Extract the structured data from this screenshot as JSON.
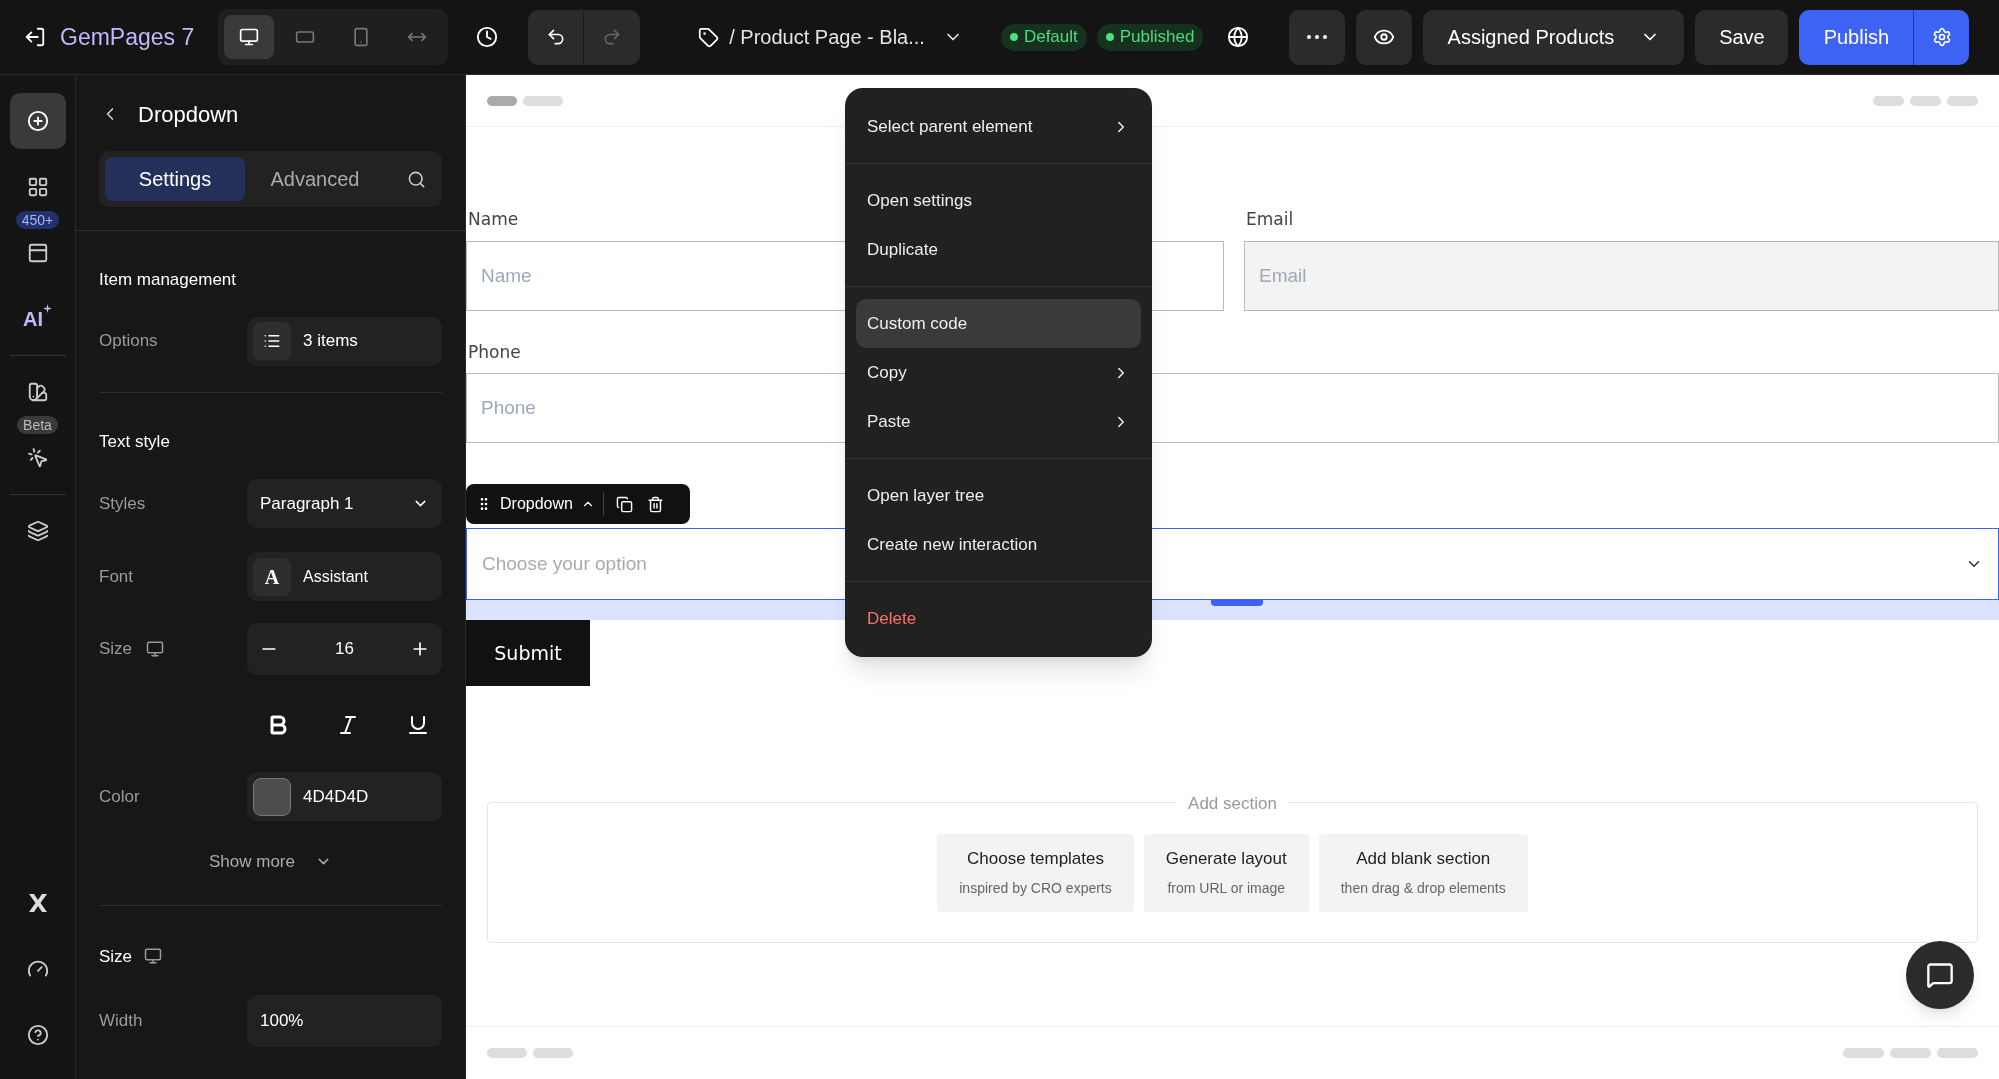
{
  "topbar": {
    "brand": "GemPages 7",
    "device_modes": [
      {
        "kind": "desktop",
        "selected": true
      },
      {
        "kind": "tablet",
        "selected": false
      },
      {
        "kind": "mobile",
        "selected": false
      },
      {
        "kind": "fit",
        "selected": false
      }
    ],
    "page_title": "/ Product Page - Bla...",
    "badges": [
      {
        "label": "Default",
        "color": "#4ade80"
      },
      {
        "label": "Published",
        "color": "#4ade80"
      }
    ],
    "assigned": "Assigned Products",
    "save": "Save",
    "publish": "Publish"
  },
  "rail": {
    "groups": [
      [
        {
          "kind": "add",
          "selected": true
        },
        {
          "kind": "elements",
          "selected": false
        },
        {
          "kind": "templates",
          "badge": "450+",
          "selected": false
        },
        {
          "kind": "ai",
          "text": "AI",
          "selected": false
        }
      ],
      [
        {
          "kind": "theme",
          "selected": false
        },
        {
          "kind": "interaction",
          "badge": "Beta",
          "selected": false
        }
      ],
      [
        {
          "kind": "layers",
          "selected": false
        }
      ]
    ],
    "bottom": [
      {
        "kind": "x",
        "selected": false
      },
      {
        "kind": "speed",
        "selected": false
      },
      {
        "kind": "help",
        "selected": false
      }
    ]
  },
  "panel": {
    "title": "Dropdown",
    "tabs": [
      {
        "label": "Settings",
        "selected": true
      },
      {
        "label": "Advanced",
        "selected": false
      }
    ],
    "item_management": {
      "heading": "Item management",
      "options_label": "Options",
      "options_value": "3 items"
    },
    "text_style": {
      "heading": "Text style",
      "styles_label": "Styles",
      "styles_value": "Paragraph 1",
      "font_label": "Font",
      "font_glyph": "A",
      "font_value": "Assistant",
      "size_label": "Size",
      "size_value": "16",
      "color_label": "Color",
      "color": "#4d4d4d",
      "color_value": "4D4D4D",
      "show_more": "Show more"
    },
    "size": {
      "heading": "Size",
      "width_label": "Width",
      "width_value": "100%"
    }
  },
  "form": {
    "rows": [
      [
        {
          "label": "Name",
          "placeholder": "Name",
          "disabled": false
        },
        {
          "label": "Email",
          "placeholder": "Email",
          "disabled": true
        }
      ],
      [
        {
          "label": "Phone",
          "placeholder": "Phone",
          "disabled": false
        }
      ]
    ],
    "dropdown": {
      "toolbar_label": "Dropdown",
      "placeholder": "Choose your option",
      "selected": true
    },
    "submit": "Submit"
  },
  "context_menu": {
    "groups": [
      [
        {
          "label": "Select parent element",
          "submenu": true,
          "kind": "normal",
          "selected": false
        }
      ],
      [
        {
          "label": "Open settings",
          "submenu": false,
          "kind": "normal",
          "selected": false
        },
        {
          "label": "Duplicate",
          "submenu": false,
          "kind": "normal",
          "selected": false
        }
      ],
      [
        {
          "label": "Custom code",
          "submenu": false,
          "kind": "normal",
          "selected": true
        },
        {
          "label": "Copy",
          "submenu": true,
          "kind": "normal",
          "selected": false
        },
        {
          "label": "Paste",
          "submenu": true,
          "kind": "normal",
          "selected": false
        }
      ],
      [
        {
          "label": "Open layer tree",
          "submenu": false,
          "kind": "normal",
          "selected": false
        },
        {
          "label": "Create new interaction",
          "submenu": false,
          "kind": "normal",
          "selected": false
        }
      ],
      [
        {
          "label": "Delete",
          "submenu": false,
          "kind": "danger",
          "selected": false
        }
      ]
    ]
  },
  "add_section": {
    "title": "Add section",
    "options": [
      {
        "title": "Choose templates",
        "subtitle": "inspired by CRO experts"
      },
      {
        "title": "Generate layout",
        "subtitle": "from URL or image"
      },
      {
        "title": "Add blank section",
        "subtitle": "then drag & drop elements"
      }
    ]
  }
}
